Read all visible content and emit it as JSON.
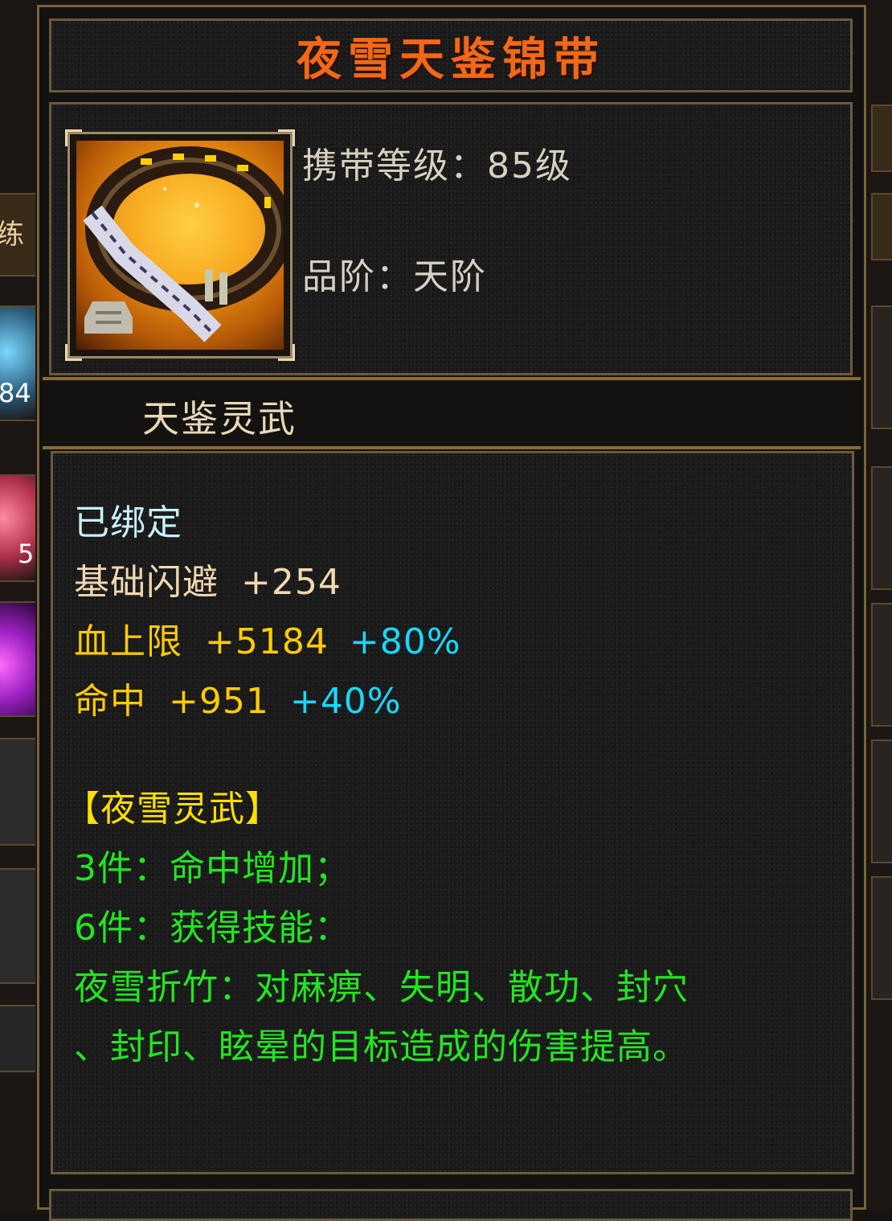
{
  "item": {
    "name": "夜雪天鉴锦带",
    "icon": "belt-icon",
    "level_line": "携带等级：85级",
    "grade_line": "品阶：天阶",
    "series": "天鉴灵武"
  },
  "stats": {
    "bound": "已绑定",
    "dodge_label": "基础闪避",
    "dodge_value": "+254",
    "hp_label": "血上限",
    "hp_value": "+5184",
    "hp_bonus": "+80%",
    "hit_label": "命中",
    "hit_value": "+951",
    "hit_bonus": "+40%"
  },
  "set_bonus": {
    "title": "【夜雪灵武】",
    "piece3": "3件：命中增加；",
    "piece6": "6件：获得技能：",
    "skill_line1": "夜雪折竹：对麻痹、失明、散功、封穴",
    "skill_line2": "、封印、眩晕的目标造成的伤害提高。"
  },
  "colors": {
    "title": "#f06818",
    "bound": "#c8f0ff",
    "stat_gold": "#ffcc00",
    "bonus_cyan": "#18d8ff",
    "set_yellow": "#ffe000",
    "set_green": "#22e622"
  },
  "background_ui": {
    "left_partial_1": "练",
    "left_partial_2": "84",
    "left_partial_3": "5"
  }
}
